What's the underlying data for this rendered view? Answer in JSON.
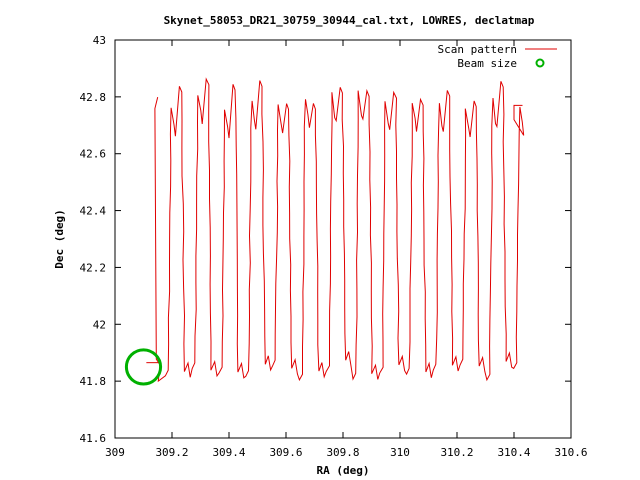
{
  "chart_data": {
    "type": "line",
    "title": "Skynet_58053_DR21_30759_30944_cal.txt, LOWRES, declatmap",
    "xlabel": "RA (deg)",
    "ylabel": "Dec (deg)",
    "xlim": [
      309,
      310.6
    ],
    "ylim": [
      41.6,
      43
    ],
    "xticks": [
      "309",
      "309.2",
      "309.4",
      "309.6",
      "309.8",
      "310",
      "310.2",
      "310.4",
      "310.6"
    ],
    "yticks": [
      "41.6",
      "41.8",
      "42",
      "42.2",
      "42.4",
      "42.6",
      "42.8",
      "43"
    ],
    "grid": false,
    "legend_position": "top-right",
    "colors": {
      "scan": "#e00000",
      "beam": "#00b000"
    },
    "series": [
      {
        "name": "Scan pattern",
        "style": "line",
        "description_ra_range": [
          309.14,
          310.41
        ],
        "dec_range": [
          41.8,
          42.87
        ],
        "sweep_count": 28,
        "sweep_ra_step": 0.047
      },
      {
        "name": "Beam size",
        "style": "marker",
        "center": [
          309.1,
          41.85
        ],
        "radius_deg": 0.06
      }
    ]
  }
}
